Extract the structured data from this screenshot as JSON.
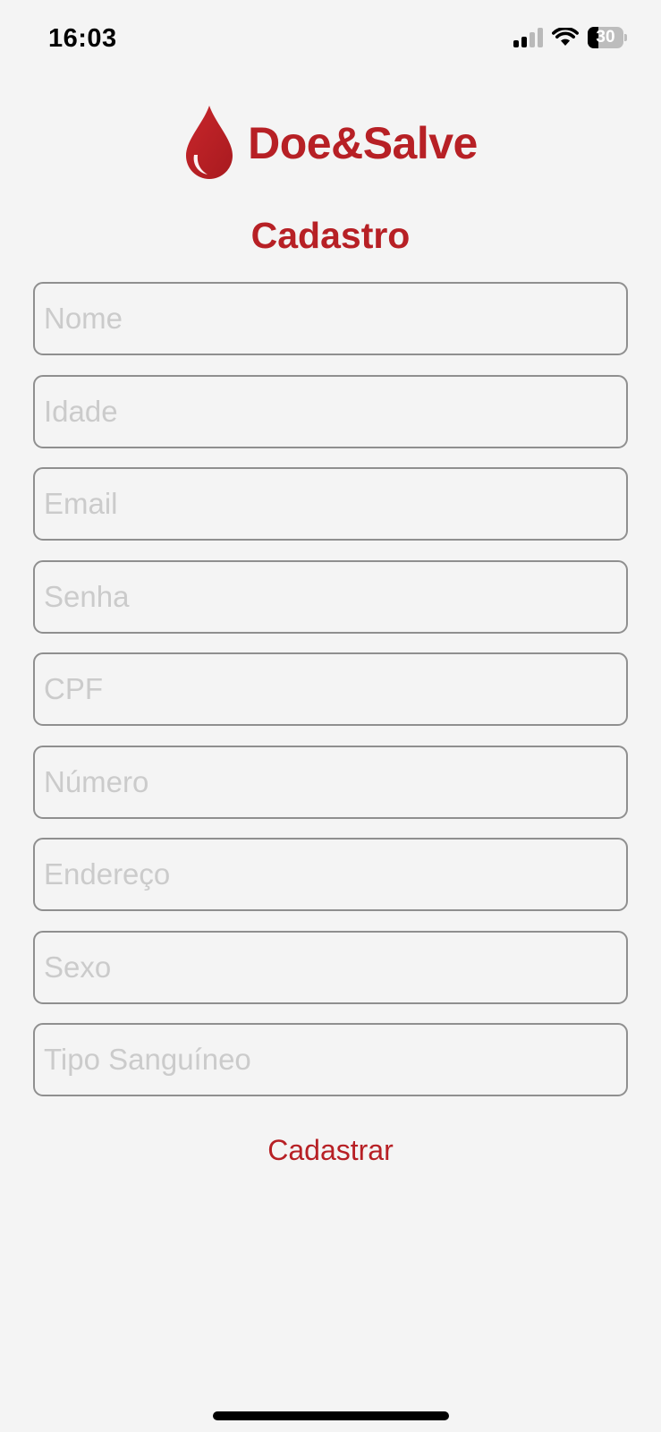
{
  "status_bar": {
    "time": "16:03",
    "battery": "30",
    "battery_level": 0.3,
    "icons": [
      "signal-icon",
      "wifi-icon",
      "battery-icon"
    ]
  },
  "logo": {
    "title": "Doe&Salve",
    "icon": "blood-drop-icon",
    "color": "#b72025"
  },
  "page": {
    "title": "Cadastro"
  },
  "form": {
    "fields": [
      {
        "name": "nome",
        "placeholder": "Nome",
        "value": ""
      },
      {
        "name": "idade",
        "placeholder": "Idade",
        "value": ""
      },
      {
        "name": "email",
        "placeholder": "Email",
        "value": ""
      },
      {
        "name": "senha",
        "placeholder": "Senha",
        "value": ""
      },
      {
        "name": "cpf",
        "placeholder": "CPF",
        "value": ""
      },
      {
        "name": "numero",
        "placeholder": "Número",
        "value": ""
      },
      {
        "name": "endereco",
        "placeholder": "Endereço",
        "value": ""
      },
      {
        "name": "sexo",
        "placeholder": "Sexo",
        "value": ""
      },
      {
        "name": "tipo-sanguineo",
        "placeholder": "Tipo Sanguíneo",
        "value": ""
      }
    ],
    "submit_label": "Cadastrar"
  }
}
